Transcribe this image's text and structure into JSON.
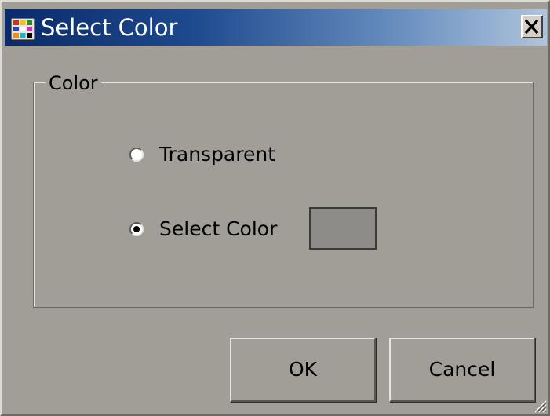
{
  "window": {
    "title": "Select Color",
    "icon": "color-palette-icon",
    "close_icon": "close-icon"
  },
  "group": {
    "legend": "Color"
  },
  "options": {
    "transparent_label": "Transparent",
    "transparent_checked": false,
    "select_color_label": "Select Color",
    "select_color_checked": true
  },
  "swatch": {
    "color": "#8e8c88"
  },
  "buttons": {
    "ok_label": "OK",
    "cancel_label": "Cancel"
  },
  "colors": {
    "dialog_background": "#a19e97",
    "titlebar_start": "#0a2a6a",
    "titlebar_end": "#b0c4dc"
  }
}
